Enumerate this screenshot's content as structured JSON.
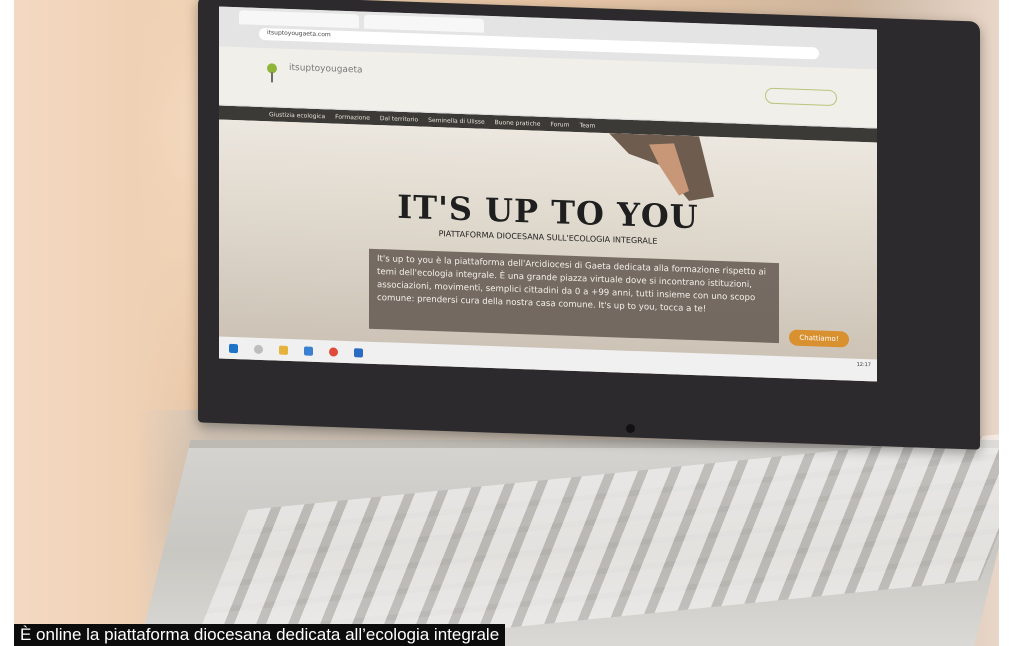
{
  "browser": {
    "tab1": "",
    "tab2": "",
    "url": "itsuptoyougaeta.com"
  },
  "site": {
    "name": "itsuptoyougaeta",
    "tagline": "",
    "register_button": "",
    "nav": [
      "",
      "Giustizia ecologica",
      "Formazione",
      "Dal territorio",
      "Seminella di Ulisse",
      "Buone pratiche",
      "Forum",
      "Team"
    ],
    "hero_title": "IT'S UP TO YOU",
    "hero_subtitle": "PIATTAFORMA DIOCESANA SULL'ECOLOGIA INTEGRALE",
    "hero_text": "It's up to you è la piattaforma dell'Arcidiocesi di Gaeta dedicata alla formazione rispetto ai temi dell'ecologia integrale. È una grande piazza virtuale dove si incontrano istituzioni, associazioni, movimenti, semplici cittadini da 0 a +99 anni, tutti insieme con uno scopo comune: prendersi cura della nostra casa comune. It's up to you, tocca a te!",
    "chat_button": "Chattiamo!"
  },
  "taskbar": {
    "time": "12:17"
  },
  "caption": "È online la piattaforma diocesana dedicata all’ecologia integrale"
}
